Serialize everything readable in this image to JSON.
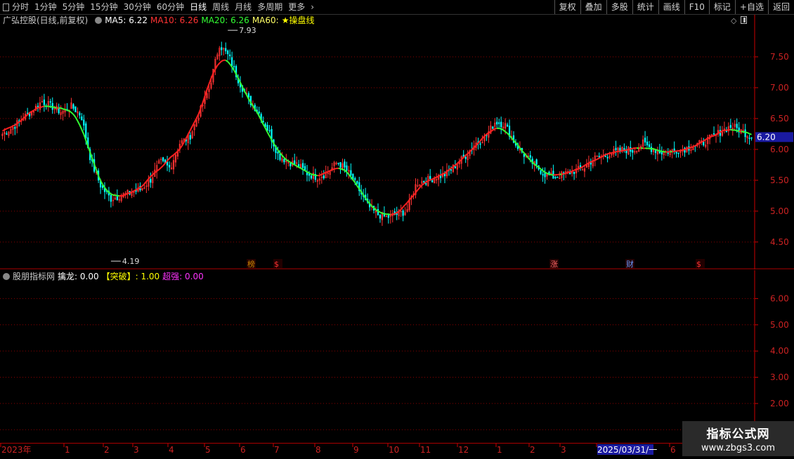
{
  "toolbar": {
    "left": [
      "分时",
      "1分钟",
      "5分钟",
      "15分钟",
      "30分钟",
      "60分钟",
      "日线",
      "周线",
      "月线",
      "多周期",
      "更多"
    ],
    "active": "日线",
    "right": [
      "复权",
      "叠加",
      "多股",
      "统计",
      "画线",
      "F10",
      "标记",
      "+自选",
      "返回"
    ]
  },
  "main_legend": {
    "title": "广弘控股(日线,前复权)",
    "ma5": "MA5: 6.22",
    "ma10": "MA10: 6.26",
    "ma20": "MA20: 6.26",
    "ma60": "MA60:",
    "star": "★操盘线"
  },
  "sub_legend": {
    "title": "股朋指标网",
    "qinlong": "擒龙: 0.00",
    "tupo": "【突破】: 1.00",
    "chaoqiang_label": "超强",
    "chaoqiang_value": ": 0.00"
  },
  "annotations": {
    "high": "7.93",
    "low": "4.19",
    "last_price": "6.20"
  },
  "event_markers": [
    "榜",
    "$",
    "涨",
    "财",
    "$"
  ],
  "colors": {
    "up": "#ff3333",
    "down": "#00ffff",
    "line_up": "#ff2020",
    "line_down": "#33ff33",
    "ma5": "#ffffff",
    "ma10": "#ff3333",
    "ma20": "#33ff33",
    "ma60": "#ffff66",
    "grid": "#8b0000",
    "axis": "#cc0000"
  },
  "date_axis": {
    "labels": [
      "2023年",
      "1",
      "2",
      "3",
      "4",
      "5",
      "6",
      "7",
      "8",
      "9",
      "10",
      "11",
      "12",
      "1",
      "2",
      "3",
      "2025/03/31/一",
      "6"
    ]
  },
  "watermark": {
    "line1": "指标公式网",
    "line2": "www.zbgs3.com"
  },
  "chart_data": [
    {
      "type": "candlestick",
      "title": "广弘控股(日线,前复权)",
      "ylim": [
        4.1,
        8.0
      ],
      "yticks": [
        4.5,
        5.0,
        5.5,
        6.0,
        6.5,
        7.0,
        7.5
      ],
      "ytick_labels": [
        "4.50",
        "5.00",
        "5.50",
        "6.00",
        "6.50",
        "7.00",
        "7.50"
      ],
      "key_points": [
        {
          "label": "high",
          "value": 7.93
        },
        {
          "label": "low",
          "value": 4.19
        },
        {
          "label": "last",
          "value": 6.2
        }
      ],
      "close_path": [
        6.25,
        6.35,
        6.5,
        6.62,
        6.78,
        6.7,
        6.6,
        6.7,
        6.55,
        5.8,
        5.4,
        5.2,
        5.25,
        5.3,
        5.35,
        5.5,
        5.8,
        5.7,
        6.1,
        6.2,
        6.6,
        7.0,
        7.7,
        7.5,
        7.1,
        6.8,
        6.6,
        6.3,
        5.9,
        5.8,
        5.75,
        5.6,
        5.55,
        5.62,
        5.8,
        5.65,
        5.4,
        5.1,
        4.95,
        4.9,
        4.95,
        5.0,
        5.45,
        5.5,
        5.55,
        5.6,
        5.75,
        5.9,
        6.1,
        6.2,
        6.45,
        6.4,
        6.1,
        5.9,
        5.75,
        5.6,
        5.55,
        5.6,
        5.65,
        5.7,
        5.85,
        5.9,
        5.95,
        6.0,
        5.98,
        6.1,
        6.0,
        5.95,
        5.98,
        6.0,
        6.05,
        6.1,
        6.2,
        6.3,
        6.38,
        6.3,
        6.2
      ],
      "trend_line_last": 6.26
    },
    {
      "type": "line",
      "title": "股朋指标网",
      "ylim": [
        0.5,
        6.6
      ],
      "yticks": [
        1,
        2,
        3,
        4,
        5,
        6
      ],
      "ytick_labels": [
        "1.00",
        "2.00",
        "3.00",
        "4.00",
        "5.00",
        "6.00"
      ],
      "series": [
        {
          "name": "擒龙",
          "values": [
            0.0
          ]
        },
        {
          "name": "【突破】",
          "values": [
            1.0
          ]
        },
        {
          "name": "超强",
          "values": [
            0.0
          ]
        }
      ]
    }
  ]
}
